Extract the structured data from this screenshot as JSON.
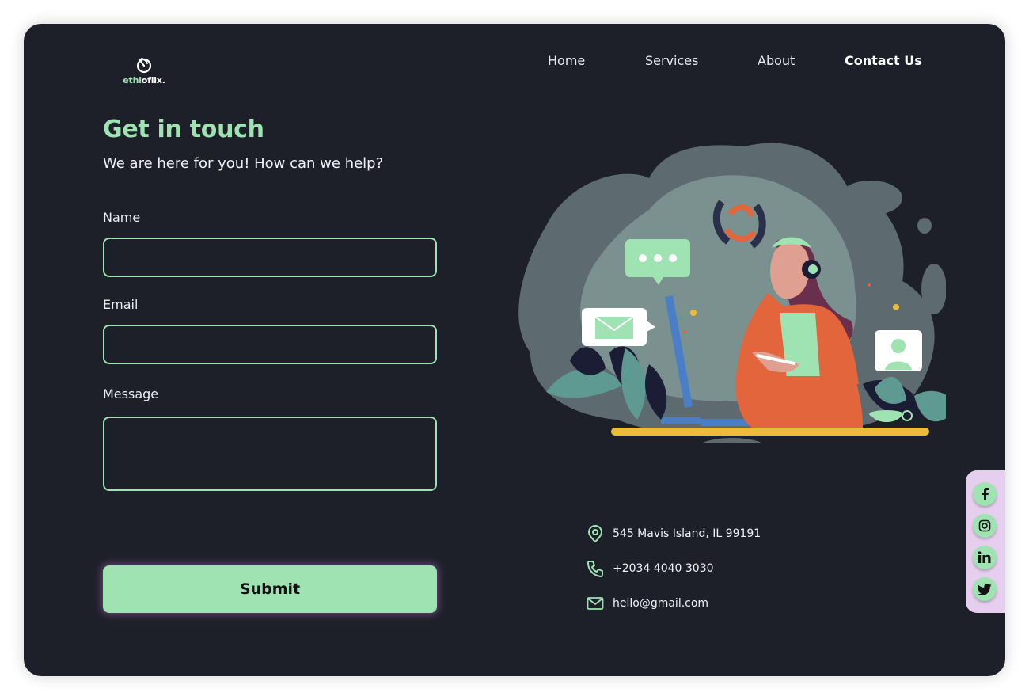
{
  "brand": {
    "name_prefix": "ethi",
    "name_suffix": "oflix."
  },
  "nav": {
    "items": [
      {
        "label": "Home"
      },
      {
        "label": "Services"
      },
      {
        "label": "About"
      },
      {
        "label": "Contact Us",
        "active": true
      }
    ]
  },
  "hero": {
    "title": "Get in touch",
    "subtitle": "We are here for you! How can we help?"
  },
  "form": {
    "name_label": "Name",
    "name_value": "",
    "email_label": "Email",
    "email_value": "",
    "message_label": "Message",
    "message_value": "",
    "submit_label": "Submit"
  },
  "contact": {
    "address": "545 Mavis Island, IL 99191",
    "phone": "+2034 4040 3030",
    "email": "hello@gmail.com"
  },
  "social": {
    "icons": [
      "facebook-icon",
      "instagram-icon",
      "linkedin-icon",
      "twitter-icon"
    ]
  },
  "colors": {
    "background": "#1e2029",
    "accent": "#9ee3b1",
    "social_panel": "#e6cfee",
    "illustration_jacket": "#e3653c",
    "illustration_highlight": "#e9bd3a"
  }
}
